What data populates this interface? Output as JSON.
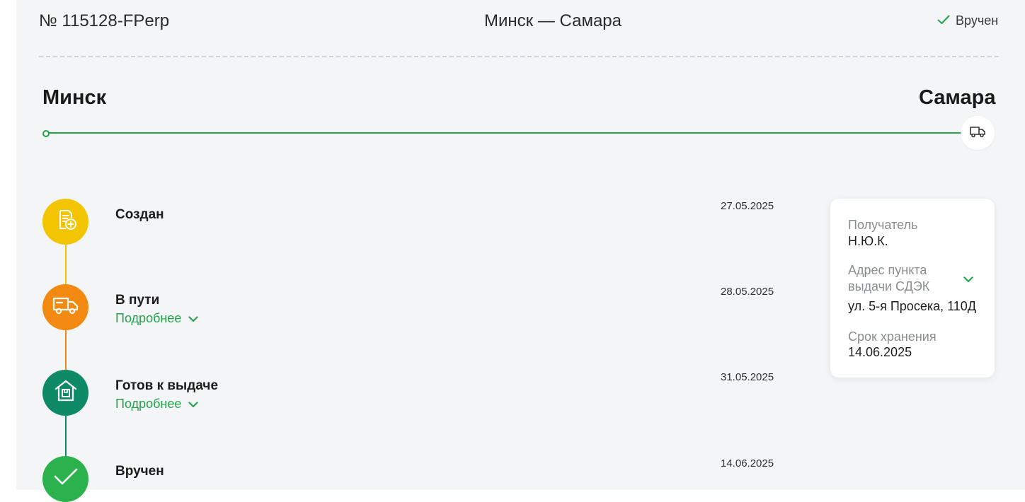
{
  "header": {
    "order_number": "№ 115128-FPerp",
    "route": "Минск — Самара",
    "status": "Вручен"
  },
  "route": {
    "from": "Минск",
    "to": "Самара"
  },
  "timeline": [
    {
      "title": "Создан",
      "date": "27.05.2025",
      "icon": "document-plus-icon"
    },
    {
      "title": "В пути",
      "date": "28.05.2025",
      "more": "Подробнее",
      "icon": "delivery-truck-icon"
    },
    {
      "title": "Готов к выдаче",
      "date": "31.05.2025",
      "more": "Подробнее",
      "icon": "warehouse-icon"
    },
    {
      "title": "Вручен",
      "date": "14.06.2025",
      "icon": "checkmark-icon"
    }
  ],
  "info_card": {
    "recipient_label": "Получатель",
    "recipient_value": "Н.Ю.К.",
    "address_label": "Адрес пункта выдачи СДЭК",
    "address_value": "ул. 5-я Просека, 110Д",
    "storage_label": "Срок хранения",
    "storage_value": "14.06.2025"
  },
  "colors": {
    "accent_green": "#24a34b",
    "step_created": "#f2c500",
    "step_in_transit": "#f28a12",
    "step_ready": "#0f8a67",
    "step_delivered": "#2bb24c"
  }
}
